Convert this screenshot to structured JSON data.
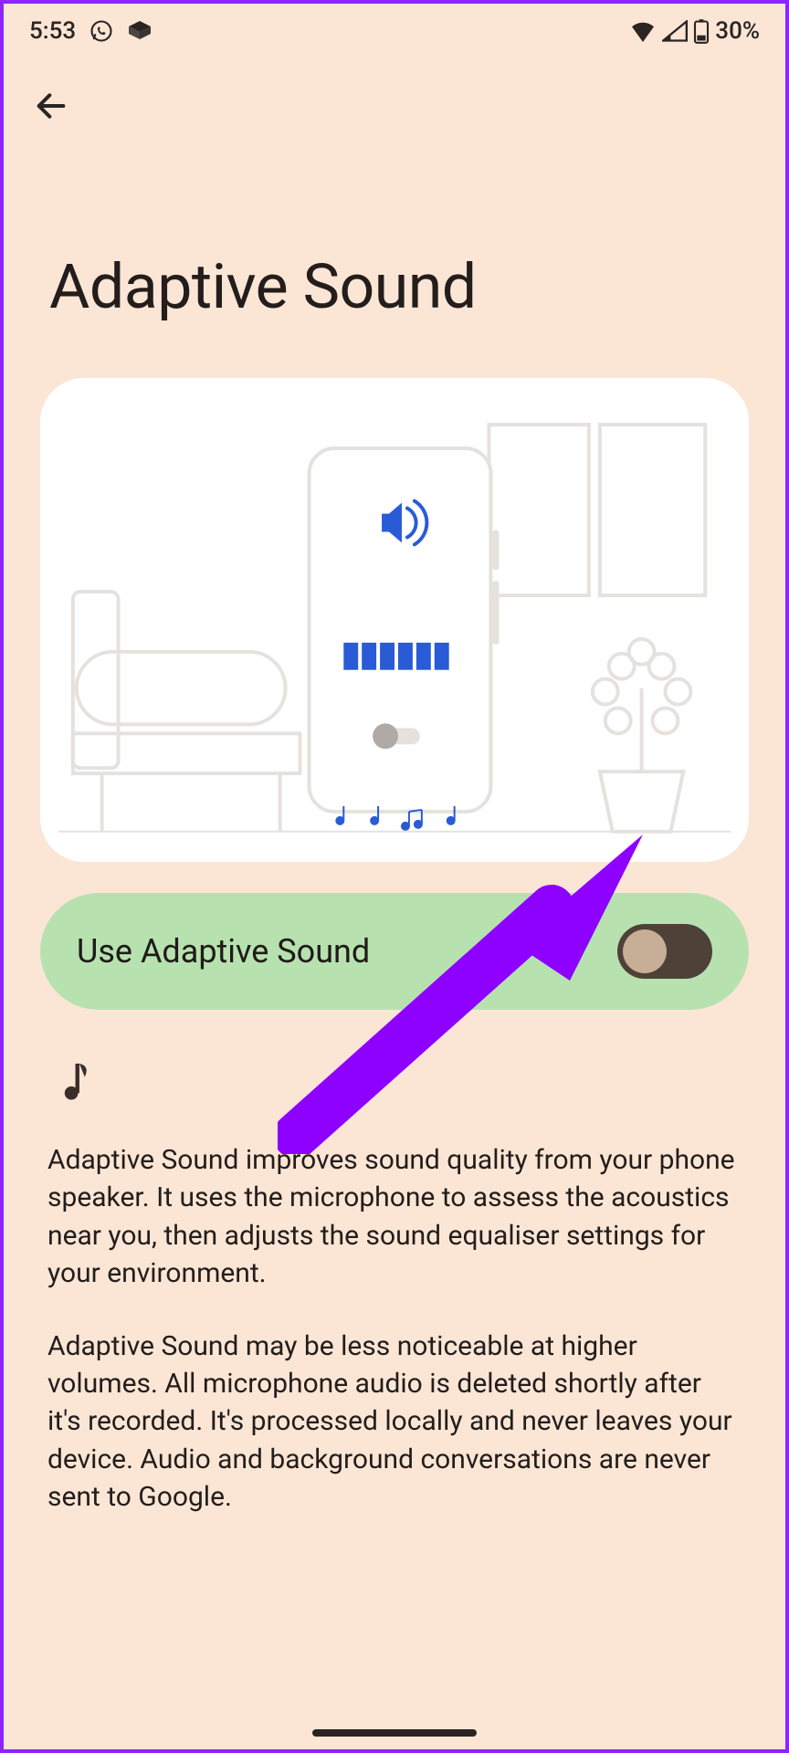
{
  "status_bar": {
    "time": "5:53",
    "battery_pct": "30%"
  },
  "page": {
    "title": "Adaptive Sound"
  },
  "toggle": {
    "label": "Use Adaptive Sound",
    "state": false
  },
  "description": {
    "para1": "Adaptive Sound improves sound quality from your phone speaker. It uses the microphone to assess the acoustics near you, then adjusts the sound equaliser settings for your environment.",
    "para2": "Adaptive Sound may be less noticeable at higher volumes. All microphone audio is deleted shortly after it's recorded. It's processed locally and never leaves your device. Audio and background conversations are never sent to Google."
  }
}
